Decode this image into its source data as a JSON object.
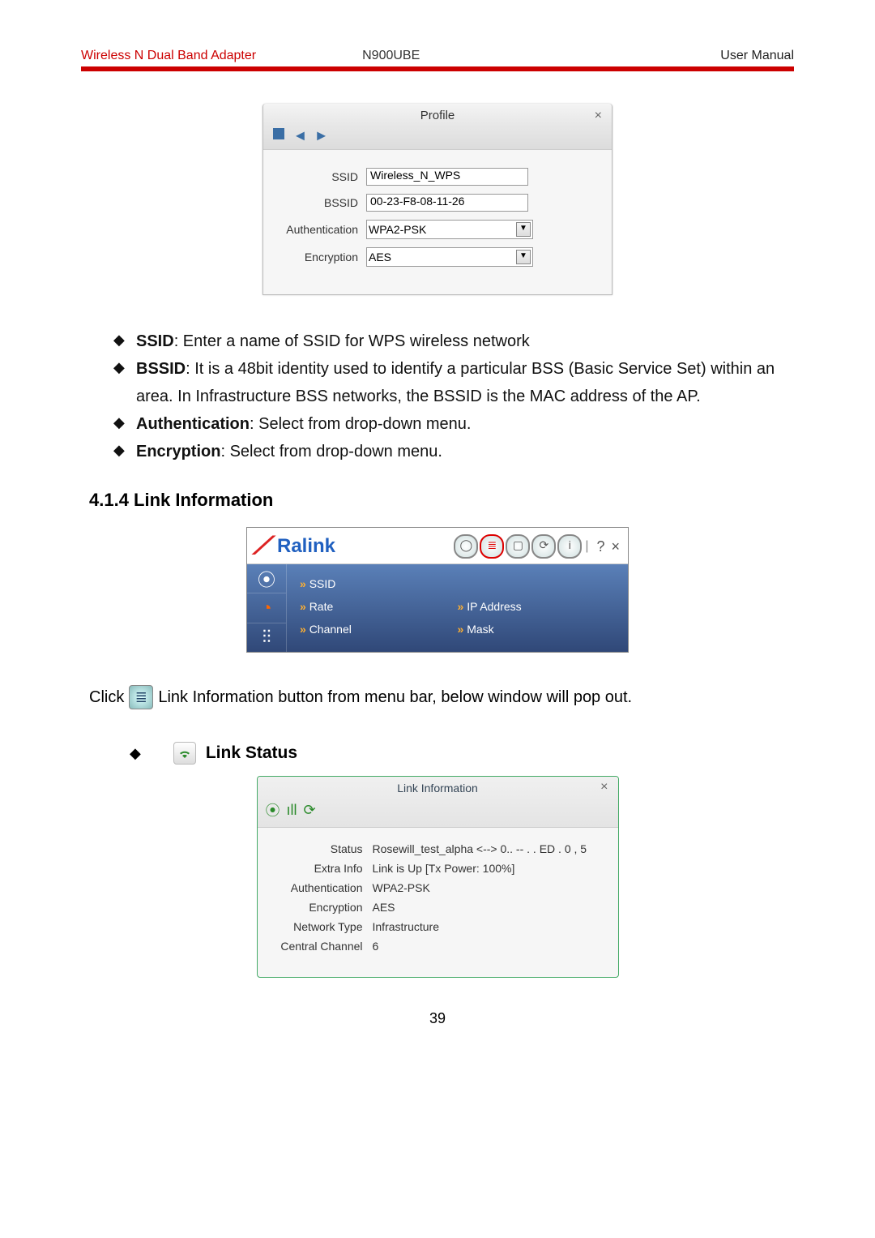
{
  "header": {
    "left": "Wireless N Dual Band Adapter",
    "mid": "N900UBE",
    "right": "User Manual"
  },
  "profile": {
    "title": "Profile",
    "close": "×",
    "ssid_label": "SSID",
    "ssid": "Wireless_N_WPS",
    "bssid_label": "BSSID",
    "bssid": "00-23-F8-08-11-26",
    "auth_label": "Authentication",
    "auth": "WPA2-PSK",
    "enc_label": "Encryption",
    "enc": "AES"
  },
  "bullets": {
    "ssid_b": "SSID",
    "ssid_t": ": Enter a name of SSID for WPS wireless network",
    "bssid_b": "BSSID",
    "bssid_t": ": It is a 48bit identity used to identify a particular BSS (Basic Service Set) within an area. In Infrastructure BSS networks, the BSSID is the MAC address of the AP.",
    "auth_b": "Authentication",
    "auth_t": ": Select from drop-down menu.",
    "enc_b": "Encryption",
    "enc_t": ": Select from drop-down menu."
  },
  "section_414": "4.1.4 Link Information",
  "ralink": {
    "brand": "Ralink",
    "rows": {
      "ssid": "SSID",
      "rate": "Rate",
      "ip": "IP Address",
      "channel": "Channel",
      "mask": "Mask"
    },
    "help": "?",
    "close": "×"
  },
  "clickline": {
    "pre": "Click",
    "post": " Link Information button from menu bar, below window will pop out."
  },
  "link_status_head": "Link Status",
  "linkinfo": {
    "title": "Link Information",
    "close": "×",
    "rows": [
      {
        "l": "Status",
        "v": "Rosewill_test_alpha <--> 0.. -- . . ED . 0 , 5"
      },
      {
        "l": "Extra Info",
        "v": "Link is Up  [Tx Power: 100%]"
      },
      {
        "l": "Authentication",
        "v": "WPA2-PSK"
      },
      {
        "l": "Encryption",
        "v": "AES"
      },
      {
        "l": "Network Type",
        "v": "Infrastructure"
      },
      {
        "l": "Central Channel",
        "v": "6"
      }
    ]
  },
  "page_num": "39"
}
